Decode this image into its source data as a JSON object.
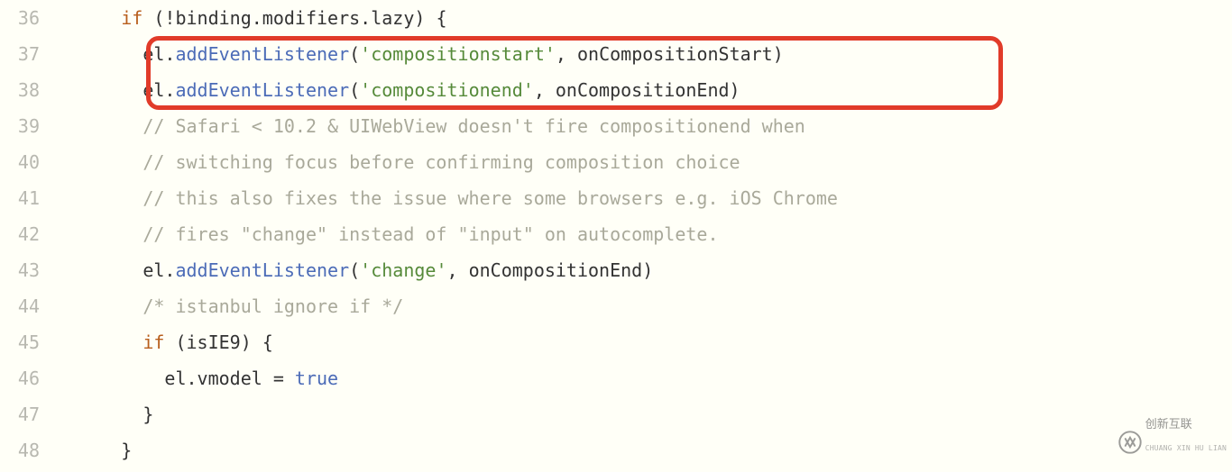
{
  "gutter": [
    "36",
    "37",
    "38",
    "39",
    "40",
    "41",
    "42",
    "43",
    "44",
    "45",
    "46",
    "47",
    "48"
  ],
  "code": {
    "l36": {
      "indent": "      ",
      "kw_if": "if",
      "p1": " (!binding.modifiers.lazy) {"
    },
    "l37": {
      "indent": "        ",
      "obj": "el.",
      "fn": "addEventListener",
      "p1": "(",
      "s": "'compositionstart'",
      "p2": ", onCompositionStart)"
    },
    "l38": {
      "indent": "        ",
      "obj": "el.",
      "fn": "addEventListener",
      "p1": "(",
      "s": "'compositionend'",
      "p2": ", onCompositionEnd)"
    },
    "l39": {
      "indent": "        ",
      "c": "// Safari < 10.2 & UIWebView doesn't fire compositionend when"
    },
    "l40": {
      "indent": "        ",
      "c": "// switching focus before confirming composition choice"
    },
    "l41": {
      "indent": "        ",
      "c": "// this also fixes the issue where some browsers e.g. iOS Chrome"
    },
    "l42": {
      "indent": "        ",
      "c": "// fires \"change\" instead of \"input\" on autocomplete."
    },
    "l43": {
      "indent": "        ",
      "obj": "el.",
      "fn": "addEventListener",
      "p1": "(",
      "s": "'change'",
      "p2": ", onCompositionEnd)"
    },
    "l44": {
      "indent": "        ",
      "c": "/* istanbul ignore if */"
    },
    "l45": {
      "indent": "        ",
      "kw_if": "if",
      "p1": " (isIE9) {"
    },
    "l46": {
      "indent": "          ",
      "txt": "el.vmodel = ",
      "bool": "true"
    },
    "l47": {
      "indent": "        ",
      "p1": "}"
    },
    "l48": {
      "indent": "      ",
      "p1": "}"
    }
  },
  "watermark": {
    "main": "创新互联",
    "sub": "CHUANG XIN HU LIAN"
  }
}
